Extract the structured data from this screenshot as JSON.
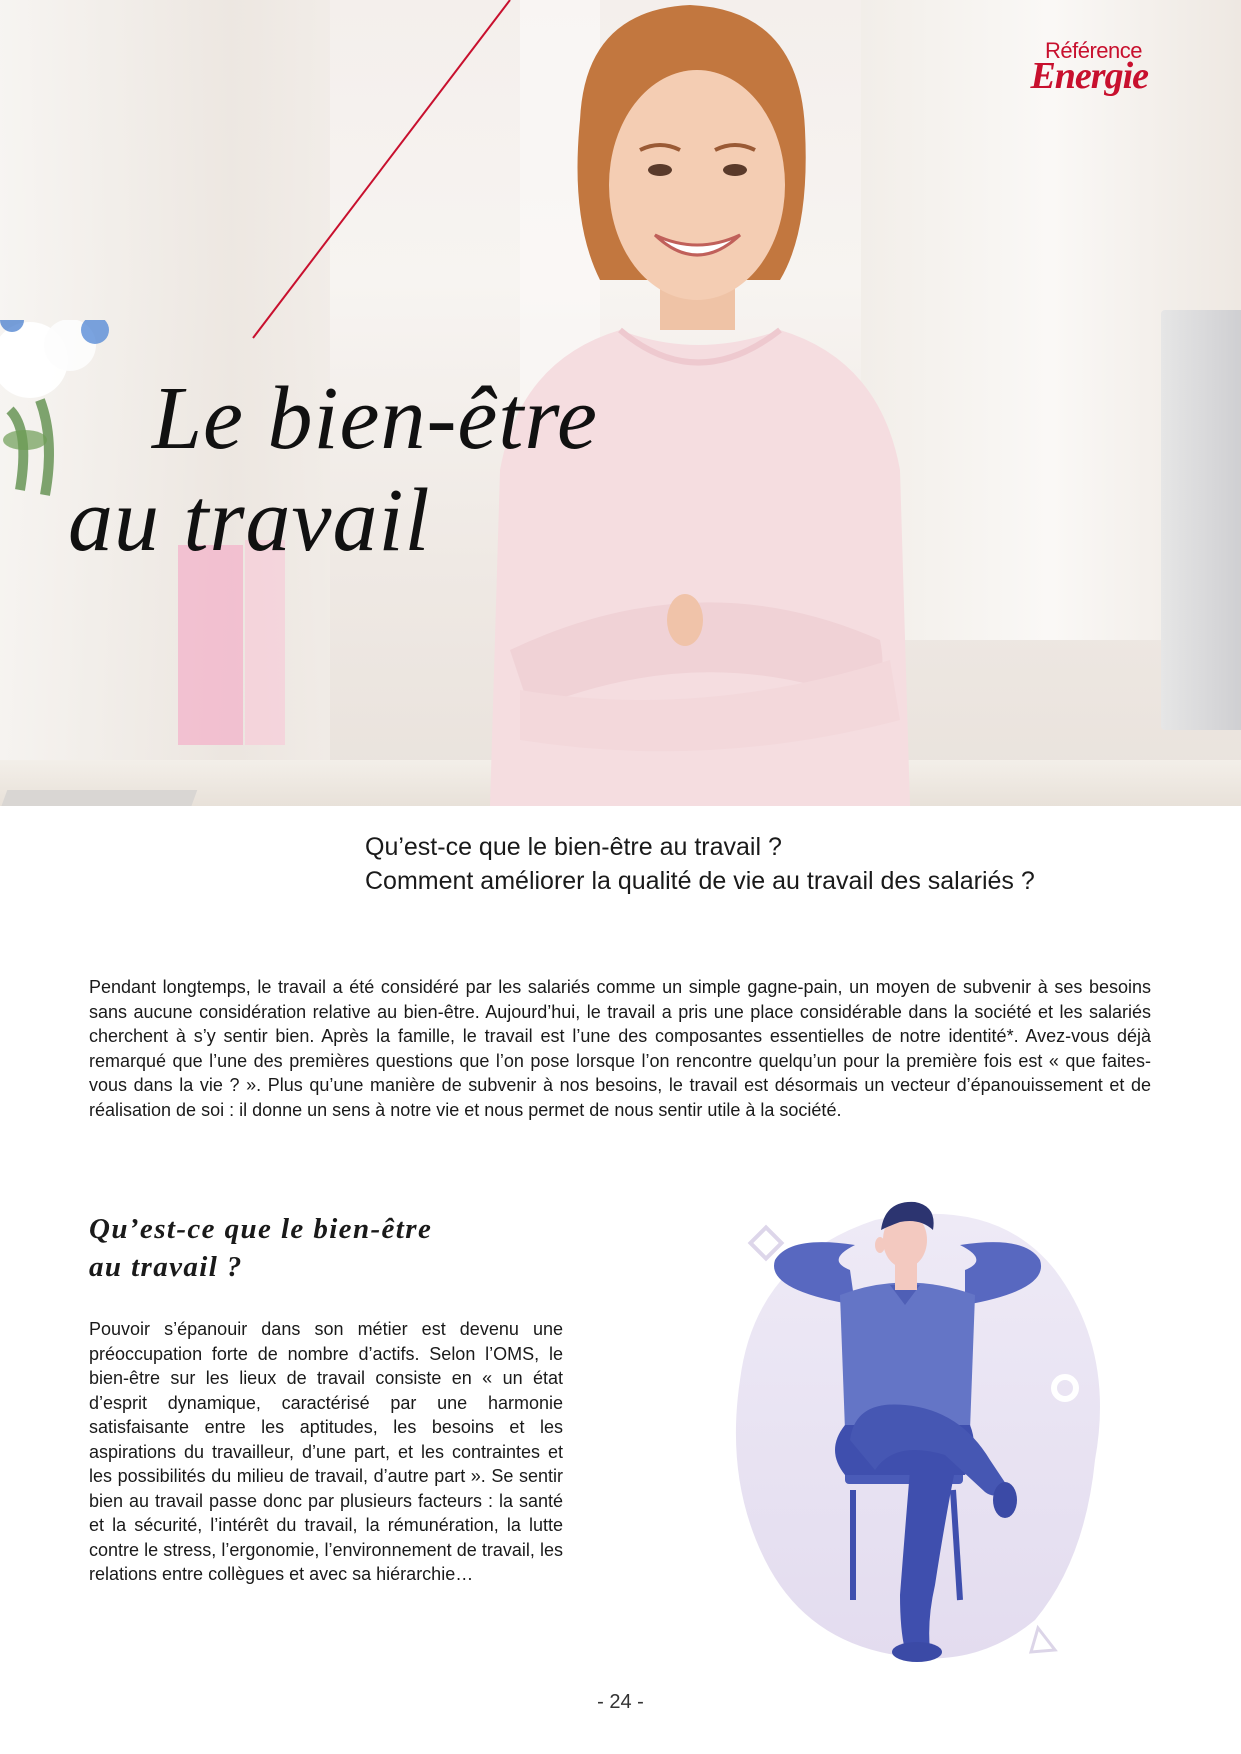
{
  "brand": {
    "line1": "Référence",
    "line2": "Energie",
    "color": "#c8102e"
  },
  "hero": {
    "title_line1": "Le bien-être",
    "title_line2": "au travail",
    "image_subject": "smiling woman with crossed arms in bright office"
  },
  "questions": {
    "q1": "Qu’est-ce que le bien-être au travail ?",
    "q2": "Comment améliorer la qualité de vie au travail des salariés ?"
  },
  "intro": "Pendant longtemps, le travail a été considéré par les salariés comme un simple gagne-pain, un moyen de subvenir à ses besoins sans aucune considération relative au bien-être. Aujourd’hui, le travail a pris une place considérable dans la société et les salariés cherchent à s’y sentir bien. Après la famille, le travail est l’une des composantes essentielles de notre identité*. Avez-vous déjà remarqué que l’une des premières questions que l’on pose lorsque l’on rencontre quelqu’un pour la première fois est « que faites-vous dans la vie ? ». Plus qu’une manière de subvenir à nos besoins, le travail est désormais un vecteur d’épanouissement et de réalisation de soi : il donne un sens à notre vie et nous permet de nous sentir utile à la société.",
  "section": {
    "heading_line1": "Qu’est-ce que le bien-être",
    "heading_line2": "au travail ?",
    "body": "Pouvoir s’épanouir dans son métier est devenu une préoccupation forte de nombre d’actifs. Selon l’OMS, le bien-être sur les lieux de travail consiste en « un état d’esprit dynamique, caractérisé par une harmonie satisfaisante entre les aptitudes, les besoins et les aspirations du travailleur, d’une part, et les contraintes et les possibilités du milieu de travail, d’autre part ». Se sentir bien au travail passe donc par plusieurs facteurs : la santé et la sécurité, l’intérêt du travail, la rémunération, la lutte contre le stress, l’ergonomie, l’environnement de travail, les relations entre collègues et avec sa hiérarchie…"
  },
  "illustration": {
    "subject": "relaxed man sitting on chair with hands behind head",
    "colors": {
      "blob": "#ece7f4",
      "shirt": "#6475c6",
      "pants": "#3f4fae",
      "skin": "#f3c9c0",
      "hair": "#2c3470"
    }
  },
  "footer": {
    "page_number": "- 24 -"
  }
}
